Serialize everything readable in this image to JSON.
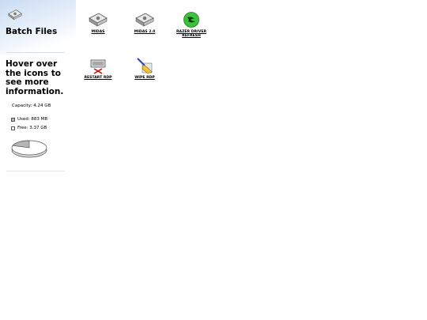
{
  "sidebar": {
    "folder_title": "Batch Files",
    "hint": "Hover over the icons to see more information.",
    "capacity": "Capacity: 4.24 GB",
    "used": "Used: 883 MB",
    "free": "Free: 3.37 GB",
    "used_fraction": 0.2
  },
  "files": [
    {
      "label": "MIDAS",
      "icon": "batch-file-gear-icon"
    },
    {
      "label": "MIDAS 2.0",
      "icon": "batch-file-gear-icon"
    },
    {
      "label": "RAZER DRIVER REFRESH",
      "icon": "razer-logo-icon"
    },
    {
      "label": "RESTART RDP",
      "icon": "restart-rdp-icon"
    },
    {
      "label": "WIPE RDP",
      "icon": "broom-icon"
    }
  ],
  "colors": {
    "panel_gradient": "#c9dcf2",
    "razer_green": "#3cc13c",
    "used_gray": "#b5b5b5"
  }
}
